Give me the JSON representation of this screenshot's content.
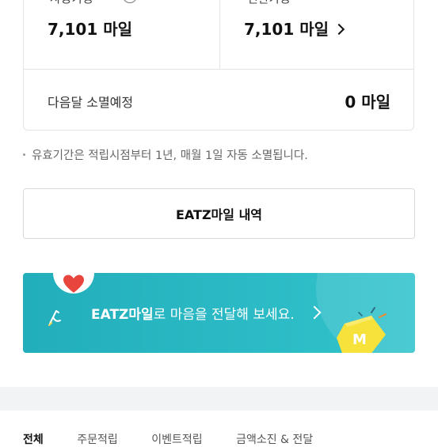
{
  "summary": {
    "left_label": "사용가능",
    "left_value": "7,101 마일",
    "right_label": "전환가능",
    "right_value": "7,101 마일",
    "expire_label": "다음달 소멸예정",
    "expire_value": "0 마일"
  },
  "notice": "유효기간은 적립시점부터 1년, 매월 1일 자동 소멸됩니다.",
  "history_button": "EATZ마일 내역",
  "banner": {
    "brand": "EATZ마일",
    "text_rest": "로 마음을 전달해 보세요.",
    "coin_letter": "M",
    "accent_color": "#2bb5c0",
    "heart_color": "#e8453c",
    "coin_color": "#f7e23b"
  },
  "filters": [
    "전체",
    "주문적립",
    "이벤트적립",
    "금액소진 & 전달"
  ]
}
